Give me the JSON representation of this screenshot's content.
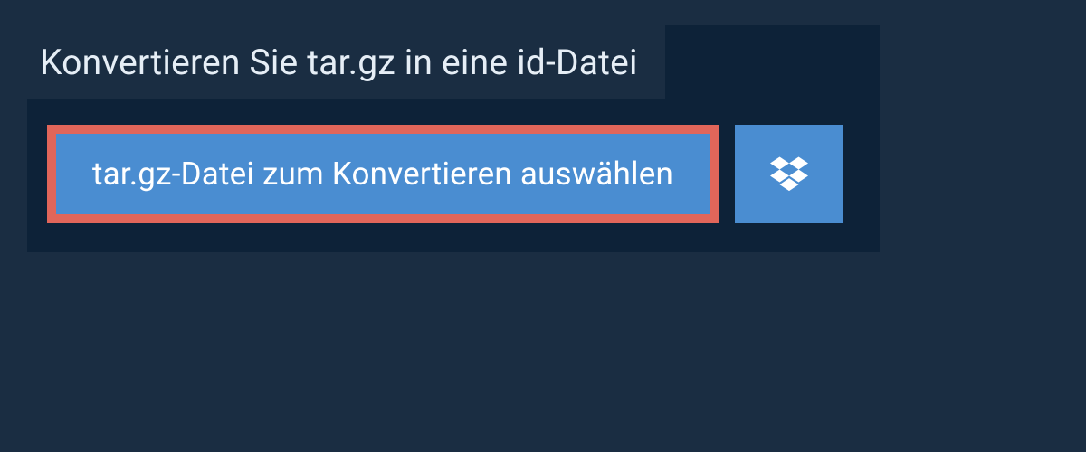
{
  "header": {
    "title": "Konvertieren Sie tar.gz in eine id-Datei"
  },
  "picker": {
    "file_button_label": "tar.gz-Datei zum Konvertieren auswählen"
  },
  "icons": {
    "dropbox": "dropbox-icon"
  }
}
